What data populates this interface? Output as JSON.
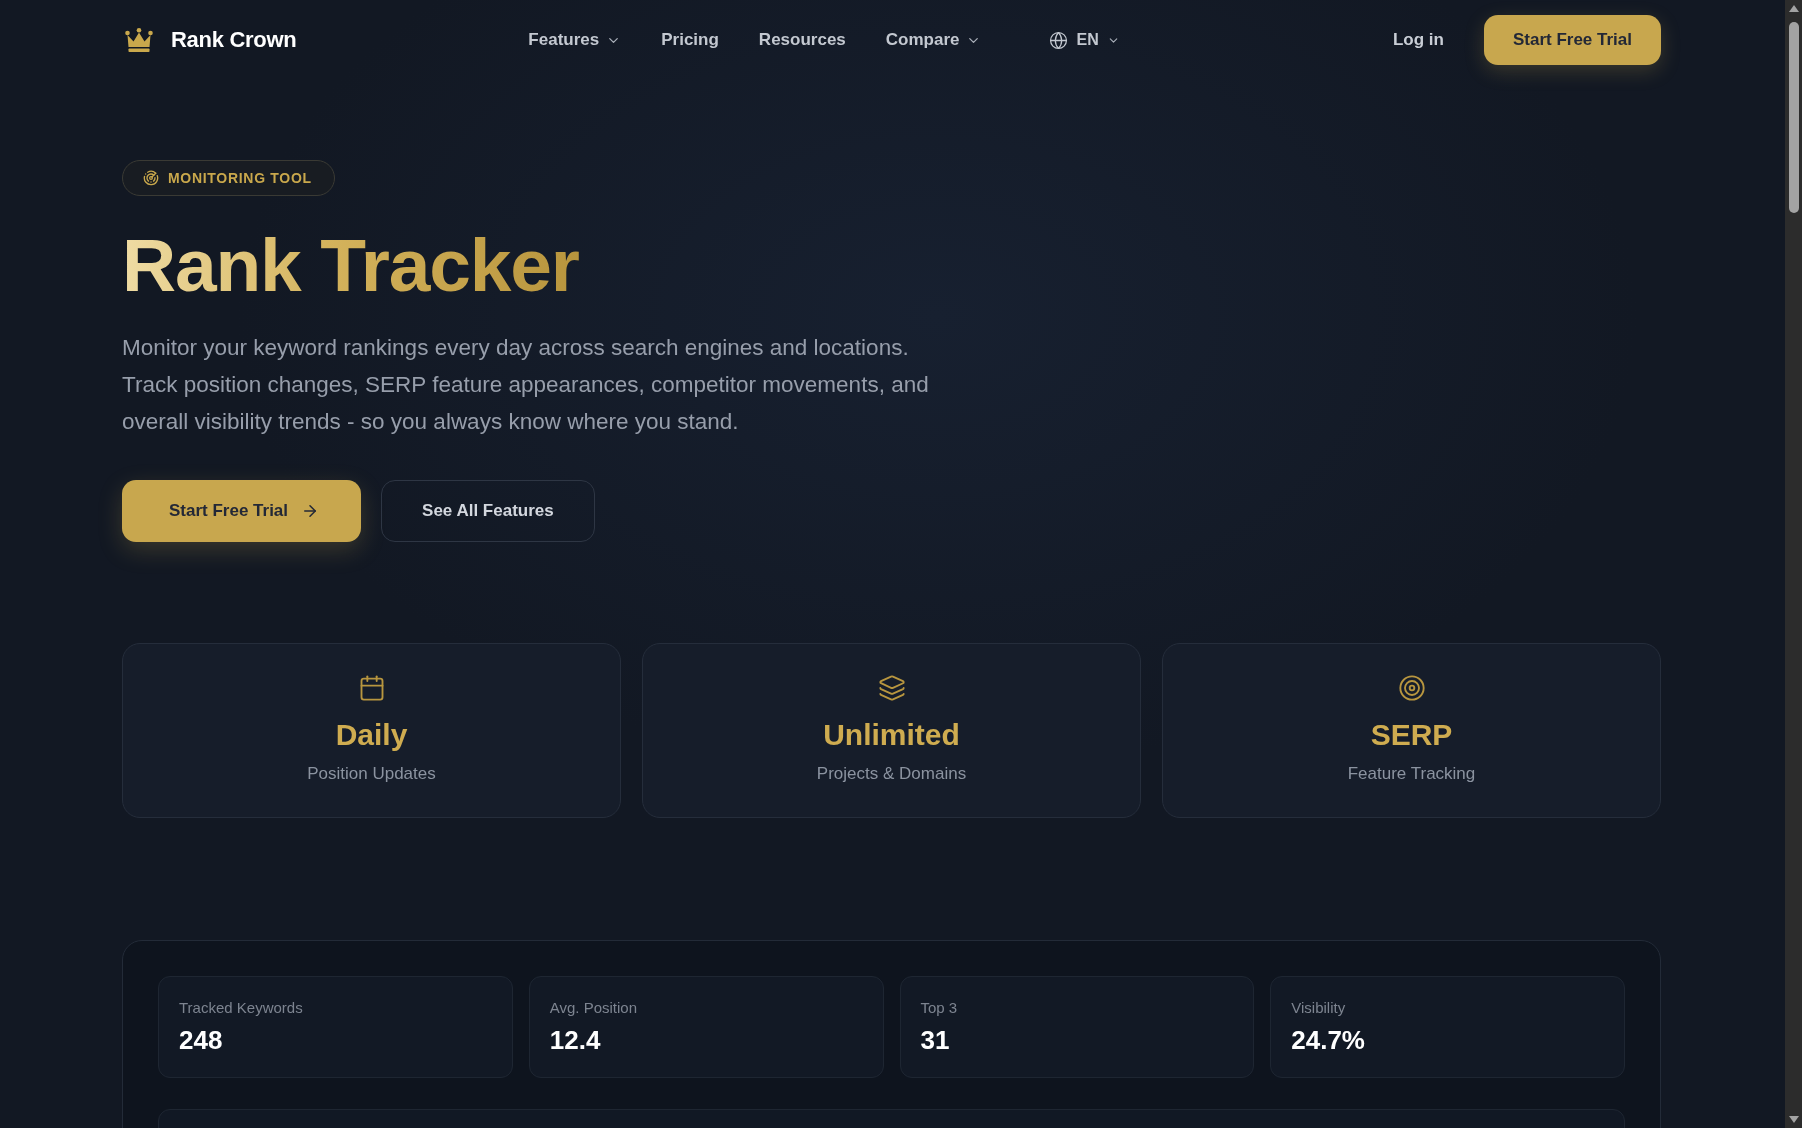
{
  "nav": {
    "brand": "Rank Crown",
    "links": [
      {
        "label": "Features",
        "kind": "menu"
      },
      {
        "label": "Pricing",
        "kind": "link"
      },
      {
        "label": "Resources",
        "kind": "link"
      },
      {
        "label": "Compare",
        "kind": "menu"
      }
    ],
    "language": "EN",
    "login": "Log in",
    "cta": "Start Free Trial"
  },
  "hero": {
    "badge": "MONITORING TOOL",
    "title": "Rank Tracker",
    "description": "Monitor your keyword rankings every day across search engines and locations. Track position changes, SERP feature appearances, competitor movements, and overall visibility trends - so you always know where you stand.",
    "buttons": [
      {
        "label": "Start Free Trial",
        "kind": "primary"
      },
      {
        "label": "See All Features",
        "kind": "secondary"
      }
    ]
  },
  "highlights": [
    {
      "title": "Daily",
      "subtitle": "Position Updates"
    },
    {
      "title": "Unlimited",
      "subtitle": "Projects & Domains"
    },
    {
      "title": "SERP",
      "subtitle": "Feature Tracking"
    }
  ],
  "dashboard": {
    "stats": [
      {
        "label": "Tracked Keywords",
        "value": "248"
      },
      {
        "label": "Avg. Position",
        "value": "12.4"
      },
      {
        "label": "Top 3",
        "value": "31"
      },
      {
        "label": "Visibility",
        "value": "24.7%"
      }
    ]
  }
}
